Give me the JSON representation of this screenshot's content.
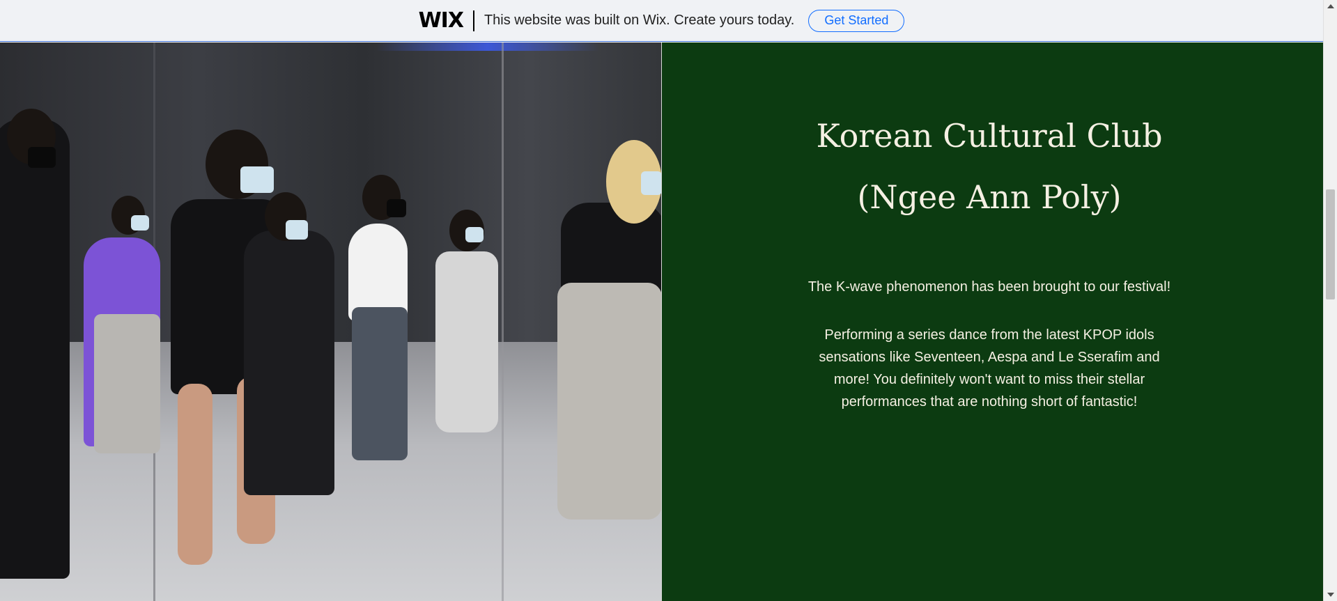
{
  "banner": {
    "logo": "WIX",
    "message": "This website was built on Wix. Create yours today.",
    "cta_label": "Get Started"
  },
  "section": {
    "title_line1": "Korean Cultural Club",
    "title_line2": "(Ngee Ann Poly)",
    "intro": "The K-wave phenomenon has been brought to our festival!",
    "body": "Performing a series dance from the latest KPOP idols sensations like Seventeen, Aespa and Le Sserafim and more! You definitely won't want to miss their stellar performances that are nothing short of fantastic!",
    "photo_subject": "dance-class-photo"
  },
  "colors": {
    "panel_bg": "#0c3b11",
    "panel_text": "#f5f0e3",
    "banner_bg": "#f0f2f5",
    "cta_blue": "#116dff"
  }
}
